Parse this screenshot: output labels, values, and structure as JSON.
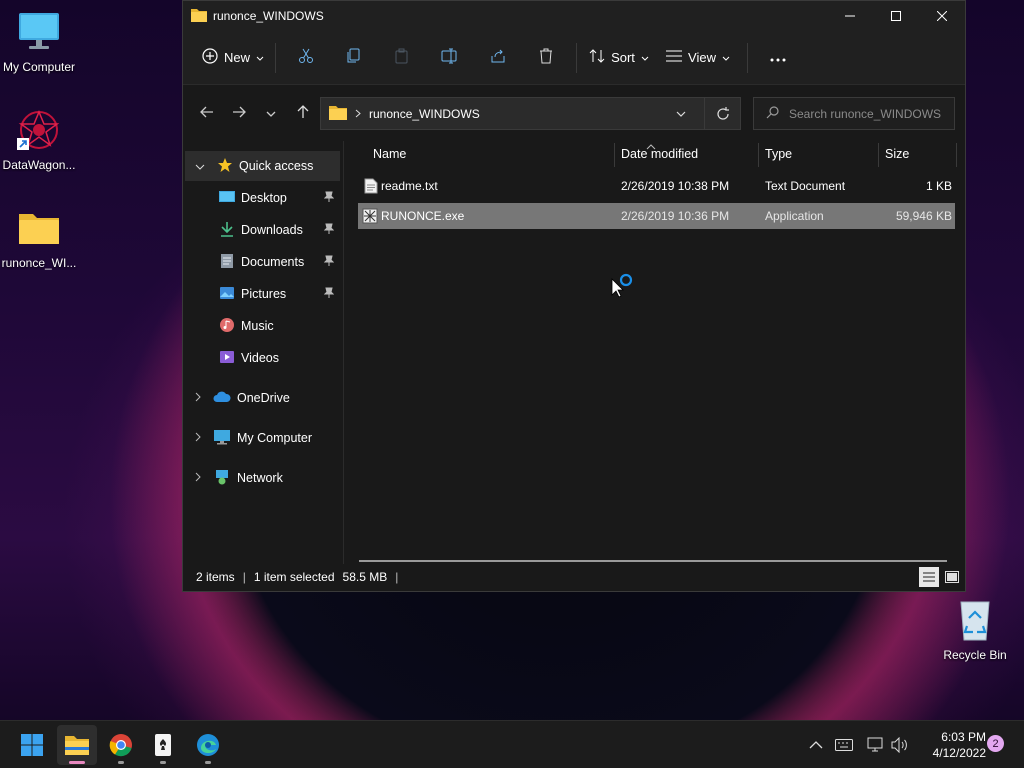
{
  "desktop": {
    "icons": [
      {
        "label": "My Computer"
      },
      {
        "label": "DataWagon..."
      },
      {
        "label": "runonce_WI..."
      },
      {
        "label": "Recycle Bin"
      }
    ]
  },
  "window": {
    "title": "runonce_WINDOWS",
    "toolbar": {
      "new_label": "New",
      "sort_label": "Sort",
      "view_label": "View"
    },
    "address": {
      "path": "runonce_WINDOWS",
      "search_placeholder": "Search runonce_WINDOWS"
    },
    "sidebar": {
      "items": [
        {
          "label": "Quick access"
        },
        {
          "label": "Desktop"
        },
        {
          "label": "Downloads"
        },
        {
          "label": "Documents"
        },
        {
          "label": "Pictures"
        },
        {
          "label": "Music"
        },
        {
          "label": "Videos"
        },
        {
          "label": "OneDrive"
        },
        {
          "label": "My Computer"
        },
        {
          "label": "Network"
        }
      ]
    },
    "columns": {
      "name": "Name",
      "date": "Date modified",
      "type": "Type",
      "size": "Size"
    },
    "files": [
      {
        "name": "readme.txt",
        "date": "2/26/2019 10:38 PM",
        "type": "Text Document",
        "size": "1 KB"
      },
      {
        "name": "RUNONCE.exe",
        "date": "2/26/2019 10:36 PM",
        "type": "Application",
        "size": "59,946 KB"
      }
    ],
    "status": {
      "items": "2 items",
      "selected": "1 item selected",
      "size": "58.5 MB"
    }
  },
  "taskbar": {
    "time": "6:03 PM",
    "date": "4/12/2022",
    "notifications": "2"
  },
  "colors": {
    "accent": "#4cc2ff",
    "selection": "#777777",
    "window_bg": "#191919"
  }
}
